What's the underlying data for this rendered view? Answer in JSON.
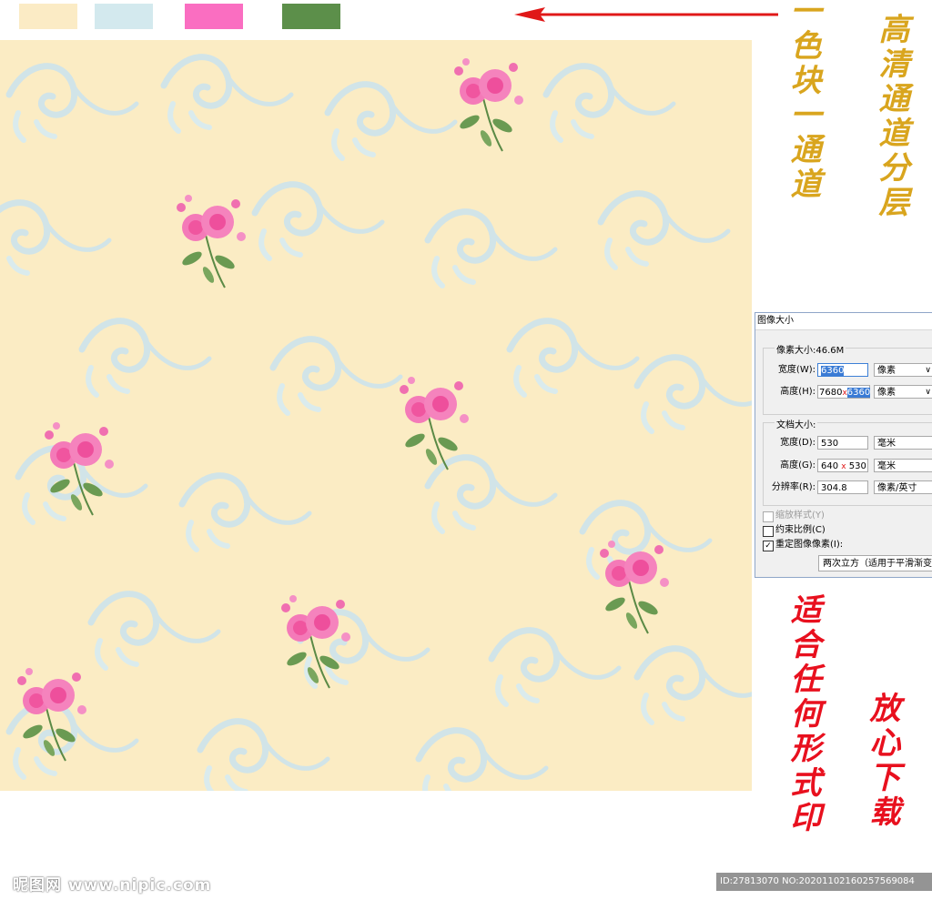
{
  "swatches": [
    {
      "name": "cream",
      "color": "#fbebc5"
    },
    {
      "name": "light-blue",
      "color": "#d3e9ee"
    },
    {
      "name": "pink",
      "color": "#fa6ec1"
    },
    {
      "name": "green",
      "color": "#5c8f4a"
    }
  ],
  "arrow_color": "#e01818",
  "texts": {
    "single_color_channel": "一色块一通道",
    "hd_channel_layers": "高清通道分层",
    "any_print": "适合任何形式印",
    "download": "放心下载"
  },
  "dialog": {
    "title": "图像大小",
    "pixel_dims_label": "像素大小:46.6M",
    "width_label": "宽度(W):",
    "width_value": "6360",
    "width_unit": "像素",
    "height_label": "高度(H):",
    "height_value_old": "7680",
    "height_value_new": "6360",
    "height_unit": "像素",
    "doc_size_label": "文档大小:",
    "doc_width_label": "宽度(D):",
    "doc_width_value": "530",
    "doc_width_unit": "毫米",
    "doc_height_label": "高度(G):",
    "doc_height_value_old": "640",
    "doc_height_value_new": "530",
    "doc_height_unit": "毫米",
    "resolution_label": "分辨率(R):",
    "resolution_value": "304.8",
    "resolution_unit": "像素/英寸",
    "scale_styles": "缩放样式(Y)",
    "constrain": "约束比例(C)",
    "resample": "重定图像像素(I):",
    "resample_method": "两次立方（适用于平滑渐变",
    "mark": "x"
  },
  "watermark": "昵图网 www.nipic.com",
  "image_id": "ID:27813070 NO:20201102160257569084",
  "colors": {
    "background": "#fbecc4",
    "gold_text": "#d9a51e",
    "red_text": "#e8101e"
  }
}
